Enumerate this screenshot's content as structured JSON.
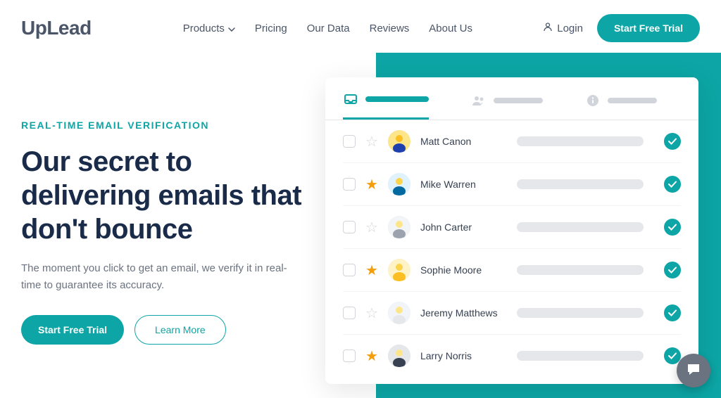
{
  "brand": "UpLead",
  "nav": {
    "items": [
      {
        "label": "Products",
        "hasDropdown": true
      },
      {
        "label": "Pricing",
        "hasDropdown": false
      },
      {
        "label": "Our Data",
        "hasDropdown": false
      },
      {
        "label": "Reviews",
        "hasDropdown": false
      },
      {
        "label": "About Us",
        "hasDropdown": false
      }
    ],
    "login": "Login",
    "cta": "Start Free Trial"
  },
  "hero": {
    "eyebrow": "REAL-TIME EMAIL VERIFICATION",
    "headline": "Our secret to delivering emails that don't bounce",
    "subheadline": "The moment you click to get an email, we verify it in real-time to guarantee its accuracy.",
    "primaryBtn": "Start Free Trial",
    "secondaryBtn": "Learn More"
  },
  "card": {
    "rows": [
      {
        "name": "Matt Canon",
        "starred": false
      },
      {
        "name": "Mike Warren",
        "starred": true
      },
      {
        "name": "John Carter",
        "starred": false
      },
      {
        "name": "Sophie Moore",
        "starred": true
      },
      {
        "name": "Jeremy Matthews",
        "starred": false
      },
      {
        "name": "Larry Norris",
        "starred": true
      }
    ]
  },
  "colors": {
    "accent": "#0da5a5",
    "dark": "#1a2b4a",
    "star": "#f59e0b"
  }
}
